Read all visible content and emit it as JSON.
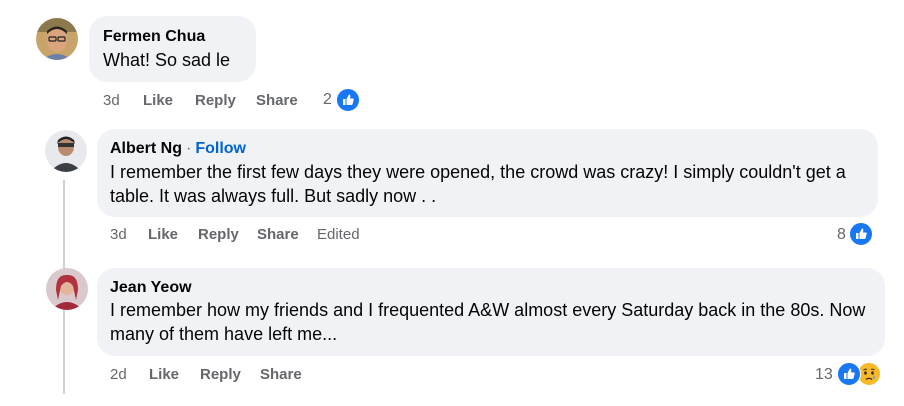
{
  "comments": [
    {
      "author": "Fermen Chua",
      "text": "What! So sad le",
      "time": "3d",
      "like": "Like",
      "reply": "Reply",
      "share": "Share",
      "reaction_count": "2",
      "reactions": [
        "like-icon"
      ]
    },
    {
      "author": "Albert Ng",
      "follow_label": "Follow",
      "text": "I remember the first few days they were opened, the crowd was crazy! I simply couldn't get a table. It was always full. But sadly now . .",
      "time": "3d",
      "like": "Like",
      "reply": "Reply",
      "share": "Share",
      "edited": "Edited",
      "reaction_count": "8",
      "reactions": [
        "like-icon"
      ]
    },
    {
      "author": "Jean Yeow",
      "text": "I remember how my friends and I frequented A&W almost every Saturday back in the 80s. Now many of them have left me...",
      "time": "2d",
      "like": "Like",
      "reply": "Reply",
      "share": "Share",
      "reaction_count": "13",
      "reactions": [
        "like-icon",
        "sad-icon"
      ]
    }
  ],
  "colors": {
    "bubble": "#f0f2f5",
    "muted": "#65676b",
    "link": "#0064d1",
    "like_blue": "#1877f2",
    "sad_yellow": "#f7b928"
  }
}
